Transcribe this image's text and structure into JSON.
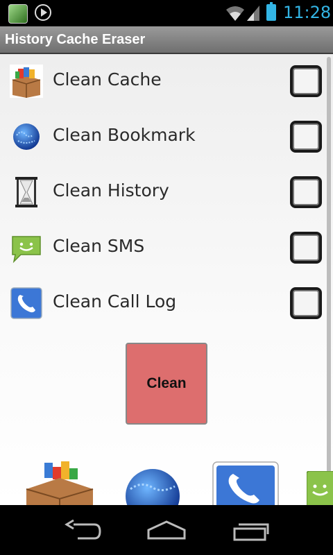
{
  "status_bar": {
    "time": "11:28",
    "icons": [
      "app-icon",
      "play-icon",
      "wifi-icon",
      "signal-icon",
      "battery-icon"
    ]
  },
  "app": {
    "title": "History Cache Eraser"
  },
  "items": [
    {
      "label": "Clean Cache",
      "icon": "cache-box-icon",
      "checked": false
    },
    {
      "label": "Clean Bookmark",
      "icon": "globe-icon",
      "checked": false
    },
    {
      "label": "Clean History",
      "icon": "hourglass-icon",
      "checked": false
    },
    {
      "label": "Clean SMS",
      "icon": "sms-icon",
      "checked": false
    },
    {
      "label": "Clean Call Log",
      "icon": "phone-icon",
      "checked": false
    }
  ],
  "actions": {
    "clean_label": "Clean"
  },
  "bottom_bar": {
    "icons": [
      "cache-box-icon",
      "globe-icon",
      "phone-icon",
      "sms-icon"
    ]
  },
  "nav": {
    "buttons": [
      "back-icon",
      "home-icon",
      "recent-apps-icon"
    ]
  },
  "colors": {
    "status_accent": "#33b5e5",
    "clean_button": "#dd6e6e",
    "title_bar": "#7f7f7f"
  }
}
